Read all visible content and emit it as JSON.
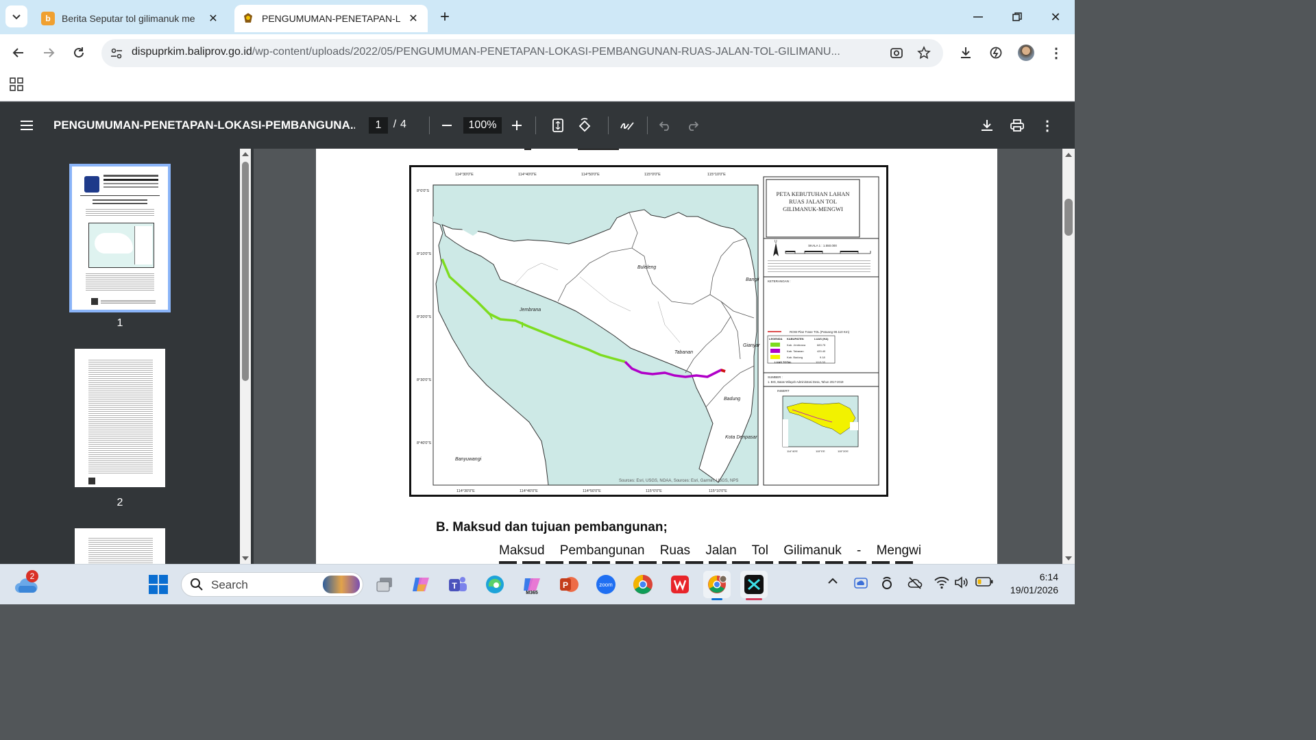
{
  "browser": {
    "tabs": [
      {
        "title": "Berita Seputar tol gilimanuk me",
        "active": false,
        "favicon": "news-favicon"
      },
      {
        "title": "PENGUMUMAN-PENETAPAN-L",
        "active": true,
        "favicon": "bali-emblem-favicon"
      }
    ],
    "url_host": "dispuprkim.baliprov.go.id",
    "url_path": "/wp-content/uploads/2022/05/PENGUMUMAN-PENETAPAN-LOKASI-PEMBANGUNAN-RUAS-JALAN-TOL-GILIMANU..."
  },
  "pdf": {
    "title": "PENGUMUMAN-PENETAPAN-LOKASI-PEMBANGUNA...",
    "page_current": "1",
    "page_sep": "/",
    "page_total": "4",
    "zoom": "100%",
    "thumbnails": [
      "1",
      "2"
    ]
  },
  "document": {
    "map": {
      "title": "PETA KEBUTUHAN LAHAN RUAS JALAN TOL GILIMANUK-MENGWI",
      "scale": "SKALA 1 : 1.550.000",
      "keterangan": "KETERANGAN :",
      "row_legend": "ROW Plan Trase TOL (Patoang 90.110 Km)",
      "legend_headers": [
        "LEGENDA",
        "KABUPATEN",
        "LUAS (HA)"
      ],
      "legend_rows": [
        {
          "kabupaten": "Kab. Jembrana",
          "luas": "683.75",
          "color": "#7ddc1f"
        },
        {
          "kabupaten": "Kab. Tabanan",
          "luas": "420.40",
          "color": "#b000c8"
        },
        {
          "kabupaten": "Kab. Badung",
          "luas": "9.18",
          "color": "#f2f200"
        }
      ],
      "legend_total_label": "LUAS TOTAL",
      "legend_total": "1113.33",
      "sumber_label": "SUMBER :",
      "sumber": "1. BIG, Batas Wilayah Administrasi Desa, Tahun 2017-2019",
      "insert_label": "INSERT",
      "lat_labels": [
        "8°0'0\"S",
        "8°10'0\"S",
        "8°20'0\"S",
        "8°30'0\"S",
        "8°40'0\"S"
      ],
      "lon_labels": [
        "114°30'0\"E",
        "114°40'0\"E",
        "114°50'0\"E",
        "115°0'0\"E",
        "115°10'0\"E"
      ],
      "region_labels": [
        "Buleleng",
        "Bangli",
        "Jembrana",
        "Gianyar",
        "Tabanan",
        "Badung",
        "Kota Denpasar",
        "Banyuwangi"
      ],
      "credits": "Sources: Esri, USGS, NOAA, Sources: Esri, Garmin, USGS, NPS"
    },
    "section_heading": "B. Maksud dan tujuan pembangunan;",
    "paragraph": "Maksud Pembangunan Ruas Jalan Tol Gilimanuk - Mengwi"
  },
  "taskbar": {
    "search_placeholder": "Search",
    "weather_badge": "2",
    "time": "6:14",
    "date": "19/01/2026",
    "apps": [
      "task-view",
      "copilot",
      "teams",
      "edge",
      "m365",
      "powerpoint",
      "zoom",
      "chrome",
      "wps",
      "chrome-profile",
      "capcut"
    ]
  }
}
